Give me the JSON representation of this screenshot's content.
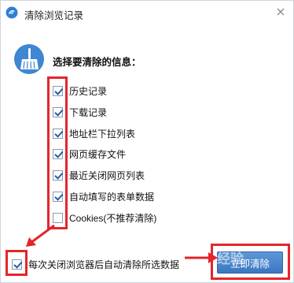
{
  "dialog": {
    "title": "清除浏览记录",
    "heading": "选择要清除的信息：",
    "options": [
      {
        "label": "历史记录",
        "checked": true
      },
      {
        "label": "下载记录",
        "checked": true
      },
      {
        "label": "地址栏下拉列表",
        "checked": true
      },
      {
        "label": "网页缓存文件",
        "checked": true
      },
      {
        "label": "最近关闭网页列表",
        "checked": true
      },
      {
        "label": "自动填写的表单数据",
        "checked": true
      },
      {
        "label": "Cookies(不推荐清除)",
        "checked": false
      }
    ],
    "auto_clear": {
      "label": "每次关闭浏览器后自动清除所选数据",
      "checked": true
    },
    "confirm_button": "立即清除",
    "watermark": "经验"
  },
  "colors": {
    "annotation_red": "#e3262a",
    "button_blue": "#3a76c2",
    "check_blue": "#1e5fa8"
  },
  "icons": [
    "browser-logo-icon",
    "close-icon",
    "broom-icon",
    "arrow-icon"
  ]
}
